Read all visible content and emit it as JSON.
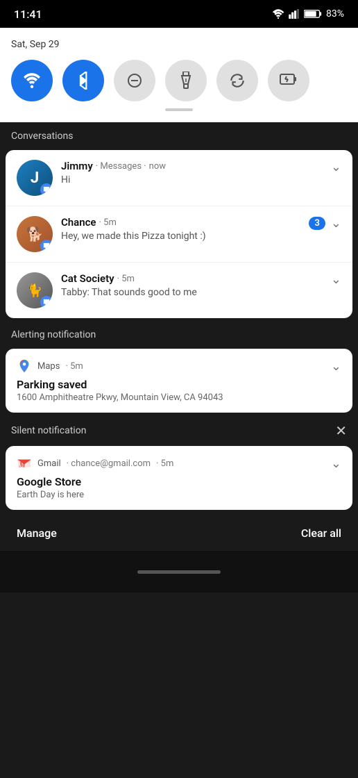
{
  "statusBar": {
    "time": "11:41",
    "battery": "83%"
  },
  "quickSettings": {
    "date": "Sat, Sep 29",
    "toggles": [
      {
        "id": "wifi",
        "icon": "wifi",
        "active": true,
        "label": "Wi-Fi"
      },
      {
        "id": "bluetooth",
        "icon": "bluetooth",
        "active": true,
        "label": "Bluetooth"
      },
      {
        "id": "dnd",
        "icon": "dnd",
        "active": false,
        "label": "Do Not Disturb"
      },
      {
        "id": "flashlight",
        "icon": "flashlight",
        "active": false,
        "label": "Flashlight"
      },
      {
        "id": "rotate",
        "icon": "rotate",
        "active": false,
        "label": "Auto Rotate"
      },
      {
        "id": "battery-saver",
        "icon": "battery-saver",
        "active": false,
        "label": "Battery Saver"
      }
    ]
  },
  "sections": {
    "conversations": {
      "label": "Conversations",
      "items": [
        {
          "id": "jimmy",
          "name": "Jimmy",
          "app": "Messages",
          "time": "now",
          "message": "Hi",
          "badge": null
        },
        {
          "id": "chance",
          "name": "Chance",
          "app": null,
          "time": "5m",
          "message": "Hey, we made this Pizza tonight :)",
          "badge": "3"
        },
        {
          "id": "cat-society",
          "name": "Cat Society",
          "app": null,
          "time": "5m",
          "message": "Tabby: That sounds good to me",
          "badge": null
        }
      ]
    },
    "alerting": {
      "label": "Alerting notification",
      "maps": {
        "app": "Maps",
        "time": "5m",
        "title": "Parking saved",
        "address": "1600 Amphitheatre Pkwy, Mountain View, CA 94043"
      }
    },
    "silent": {
      "label": "Silent notification",
      "gmail": {
        "app": "Gmail",
        "email": "chance@gmail.com",
        "time": "5m",
        "title": "Google Store",
        "message": "Earth Day is here"
      }
    }
  },
  "bottomBar": {
    "manage": "Manage",
    "clearAll": "Clear all"
  }
}
